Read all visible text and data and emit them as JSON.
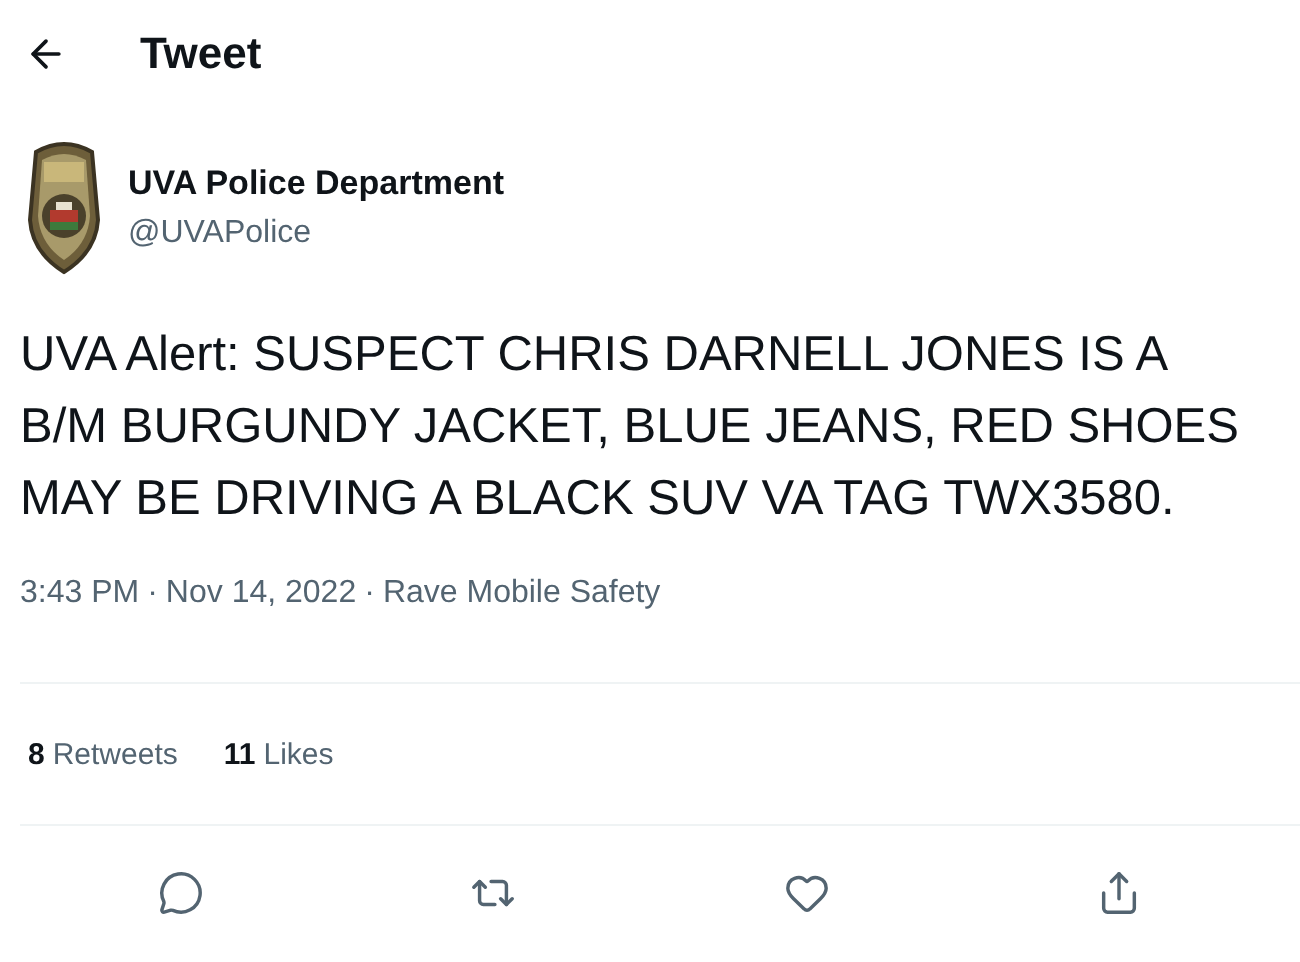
{
  "header": {
    "title": "Tweet"
  },
  "author": {
    "name": "UVA Police Department",
    "handle": "@UVAPolice"
  },
  "text": "UVA Alert: SUSPECT CHRIS DARNELL JONES IS A B/M BURGUNDY JACKET, BLUE JEANS, RED SHOES MAY BE DRIVING A BLACK SUV VA TAG TWX3580.",
  "meta": {
    "time": "3:43 PM",
    "separator": "·",
    "date": "Nov 14, 2022",
    "source": "Rave Mobile Safety"
  },
  "stats": [
    {
      "count": "8",
      "label": "Retweets"
    },
    {
      "count": "11",
      "label": "Likes"
    }
  ],
  "actions": [
    {
      "kind": "reply"
    },
    {
      "kind": "retweet"
    },
    {
      "kind": "like"
    },
    {
      "kind": "share"
    }
  ]
}
